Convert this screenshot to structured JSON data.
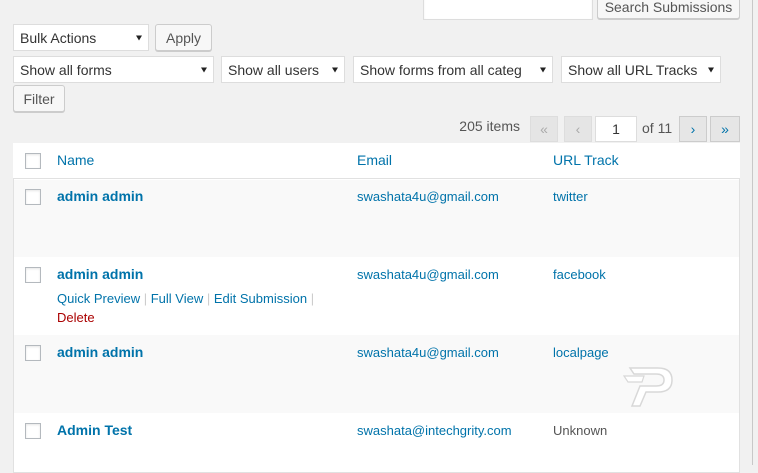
{
  "search": {
    "placeholder": "",
    "button_label": "Search Submissions"
  },
  "bulk": {
    "select_value": "Bulk Actions",
    "apply_label": "Apply"
  },
  "filters": {
    "forms": "Show all forms",
    "users": "Show all users",
    "categories": "Show forms from all categ",
    "url_tracks": "Show all URL Tracks",
    "filter_label": "Filter"
  },
  "pagination": {
    "items": "205 items",
    "first": "«",
    "prev": "‹",
    "current_page": "1",
    "of_total": "of 11",
    "next": "›",
    "last": "»"
  },
  "table": {
    "columns": {
      "name": "Name",
      "email": "Email",
      "url_track": "URL Track"
    },
    "rows": [
      {
        "name": "admin admin",
        "email": "swashata4u@gmail.com",
        "url_track": "twitter"
      },
      {
        "name": "admin admin",
        "email": "swashata4u@gmail.com",
        "url_track": "facebook"
      },
      {
        "name": "admin admin",
        "email": "swashata4u@gmail.com",
        "url_track": "localpage"
      },
      {
        "name": "Admin Test",
        "email": "swashata@intechgrity.com",
        "url_track": "Unknown"
      }
    ],
    "row_actions": {
      "quick_preview": "Quick Preview",
      "full_view": "Full View",
      "edit_submission": "Edit Submission",
      "delete": "Delete",
      "separator": "|"
    }
  },
  "colors": {
    "link": "#0073aa",
    "delete": "#a00000",
    "alt_row": "#f9f9f9"
  },
  "icons": {
    "watermark": "P-logo-watermark"
  }
}
